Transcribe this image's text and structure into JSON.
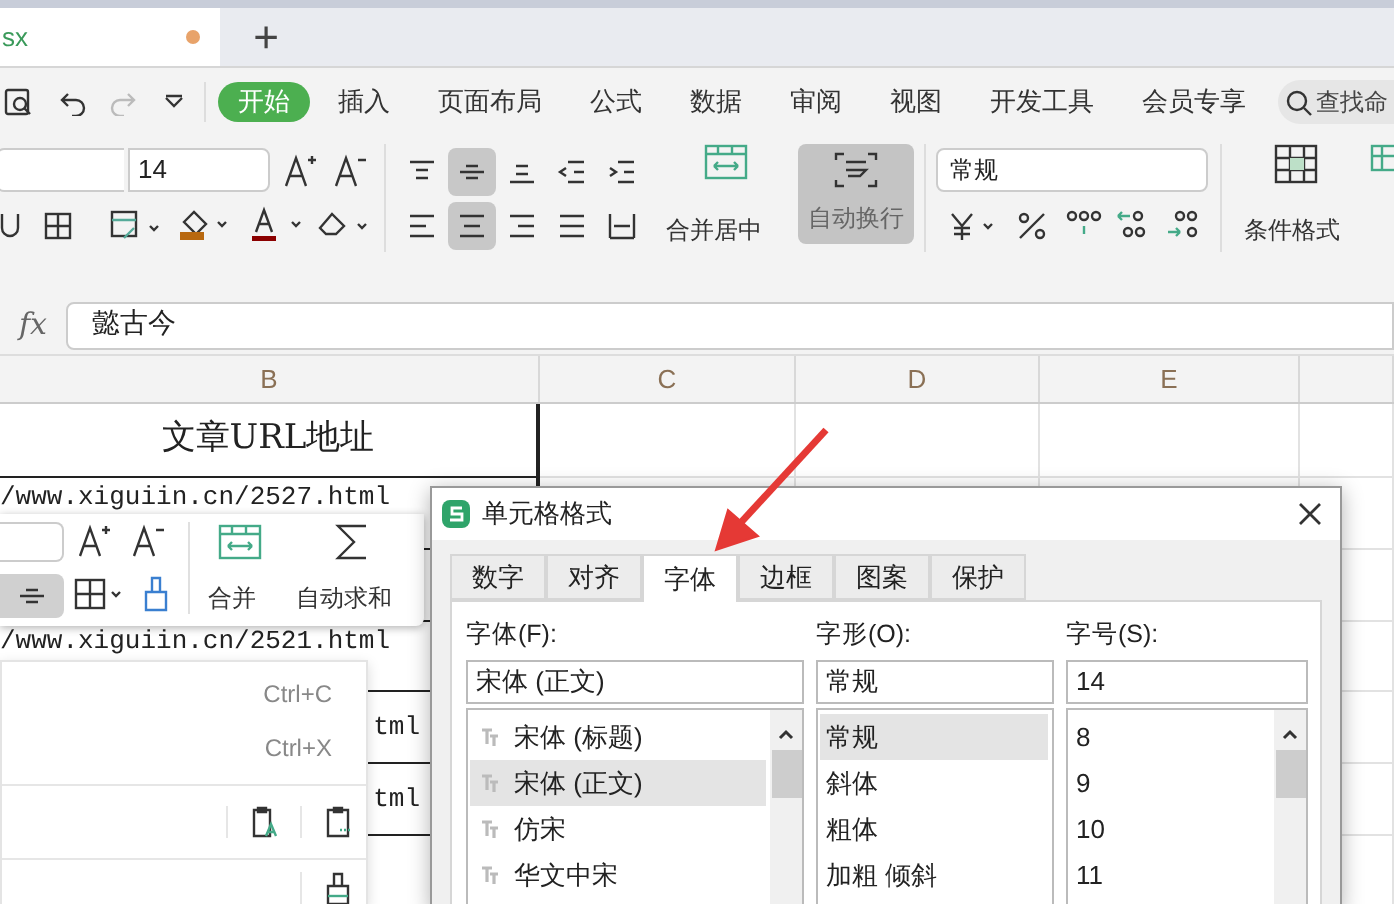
{
  "file_tab": {
    "label": "sx",
    "modified": true
  },
  "new_tab": "+",
  "menu_tabs": [
    {
      "label": "开始",
      "selected": true
    },
    {
      "label": "插入",
      "selected": false
    },
    {
      "label": "页面布局",
      "selected": false
    },
    {
      "label": "公式",
      "selected": false
    },
    {
      "label": "数据",
      "selected": false
    },
    {
      "label": "审阅",
      "selected": false
    },
    {
      "label": "视图",
      "selected": false
    },
    {
      "label": "开发工具",
      "selected": false
    },
    {
      "label": "会员专享",
      "selected": false
    }
  ],
  "search": {
    "placeholder": "查找命"
  },
  "toolbar": {
    "font_size": "14",
    "merge_label": "合并居中",
    "wrap_label": "自动换行",
    "wrap_pressed": true,
    "number_format": "常规",
    "conditional_label": "条件格式"
  },
  "formula_bar": {
    "fx": "fx",
    "value": "懿古今"
  },
  "columns": [
    "B",
    "C",
    "D",
    "E"
  ],
  "cells": [
    {
      "text": "文章URL地址",
      "kind": "header"
    },
    {
      "text": "/www.xiguiin.cn/2527.html",
      "kind": "url"
    },
    {
      "kind": "empty"
    },
    {
      "text": "/www.xiguiin.cn/2521.html",
      "kind": "url"
    },
    {
      "text": "tml",
      "kind": "url"
    },
    {
      "text": "tml",
      "kind": "url"
    }
  ],
  "mini_toolbar": {
    "merge_label": "合并",
    "sum_label": "自动求和"
  },
  "context_menu": {
    "shortcuts": [
      "Ctrl+C",
      "Ctrl+X"
    ]
  },
  "dialog": {
    "title": "单元格格式",
    "tabs": [
      {
        "label": "数字",
        "selected": false
      },
      {
        "label": "对齐",
        "selected": false
      },
      {
        "label": "字体",
        "selected": true
      },
      {
        "label": "边框",
        "selected": false
      },
      {
        "label": "图案",
        "selected": false
      },
      {
        "label": "保护",
        "selected": false
      }
    ],
    "font": {
      "label": "字体(F):",
      "value": "宋体 (正文)",
      "options": [
        {
          "label": "宋体 (标题)",
          "selected": false
        },
        {
          "label": "宋体 (正文)",
          "selected": true
        },
        {
          "label": "仿宋",
          "selected": false
        },
        {
          "label": "华文中宋",
          "selected": false
        }
      ]
    },
    "style": {
      "label": "字形(O):",
      "value": "常规",
      "options": [
        {
          "label": "常规",
          "selected": true
        },
        {
          "label": "斜体",
          "selected": false
        },
        {
          "label": "粗体",
          "selected": false
        },
        {
          "label": "加粗 倾斜",
          "selected": false
        }
      ]
    },
    "size": {
      "label": "字号(S):",
      "value": "14",
      "options": [
        {
          "label": "8",
          "selected": false
        },
        {
          "label": "9",
          "selected": false
        },
        {
          "label": "10",
          "selected": false
        },
        {
          "label": "11",
          "selected": false
        }
      ]
    }
  }
}
